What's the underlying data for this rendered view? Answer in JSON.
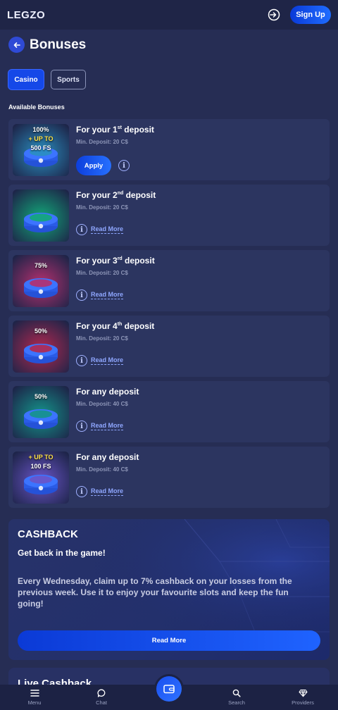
{
  "header": {
    "logo": "LEGZO",
    "signup_label": "Sign Up"
  },
  "page": {
    "title": "Bonuses"
  },
  "tabs": [
    {
      "label": "Casino",
      "active": true
    },
    {
      "label": "Sports",
      "active": false
    }
  ],
  "section_label": "Available Bonuses",
  "bonuses": [
    {
      "title_prefix": "For your 1",
      "title_sup": "st",
      "title_suffix": " deposit",
      "min": "Min. Deposit: 20 C$",
      "action": "Apply",
      "thumb_lines": [
        "100%",
        "+ UP TO",
        "500 FS"
      ],
      "thumb_color": "#2a8fc0"
    },
    {
      "title_prefix": "For your 2",
      "title_sup": "nd",
      "title_suffix": " deposit",
      "min": "Min. Deposit: 20 C$",
      "action": "Read More",
      "thumb_lines": [],
      "thumb_color": "#12a878"
    },
    {
      "title_prefix": "For your 3",
      "title_sup": "rd",
      "title_suffix": " deposit",
      "min": "Min. Deposit: 20 C$",
      "action": "Read More",
      "thumb_lines": [
        "75%"
      ],
      "thumb_color": "#b5306e"
    },
    {
      "title_prefix": "For your 4",
      "title_sup": "th",
      "title_suffix": " deposit",
      "min": "Min. Deposit: 20 C$",
      "action": "Read More",
      "thumb_lines": [
        "50%"
      ],
      "thumb_color": "#b3284f"
    },
    {
      "title_prefix": "For any deposit",
      "title_sup": "",
      "title_suffix": "",
      "min": "Min. Deposit: 40 C$",
      "action": "Read More",
      "thumb_lines": [
        "50%"
      ],
      "thumb_color": "#14948a"
    },
    {
      "title_prefix": "For any deposit",
      "title_sup": "",
      "title_suffix": "",
      "min": "Min. Deposit: 40 C$",
      "action": "Read More",
      "thumb_lines": [
        "+ UP TO",
        "100 FS"
      ],
      "thumb_color": "#6a54c8"
    }
  ],
  "cashback": {
    "title": "CASHBACK",
    "subtitle": "Get back in the game!",
    "description": "Every Wednesday, claim up to 7% cashback on your losses from the previous week. Use it to enjoy your favourite slots and keep the fun going!",
    "button": "Read More"
  },
  "live_cashback": {
    "title": "Live Cashback"
  },
  "bottom_nav": [
    {
      "label": "Menu",
      "icon": "menu-icon"
    },
    {
      "label": "Chat",
      "icon": "chat-icon"
    },
    {
      "label": "Search",
      "icon": "search-icon"
    },
    {
      "label": "Providers",
      "icon": "diamond-icon"
    }
  ],
  "colors": {
    "background": "#262d54",
    "accent": "#1548e8",
    "card": "#2c3560"
  }
}
